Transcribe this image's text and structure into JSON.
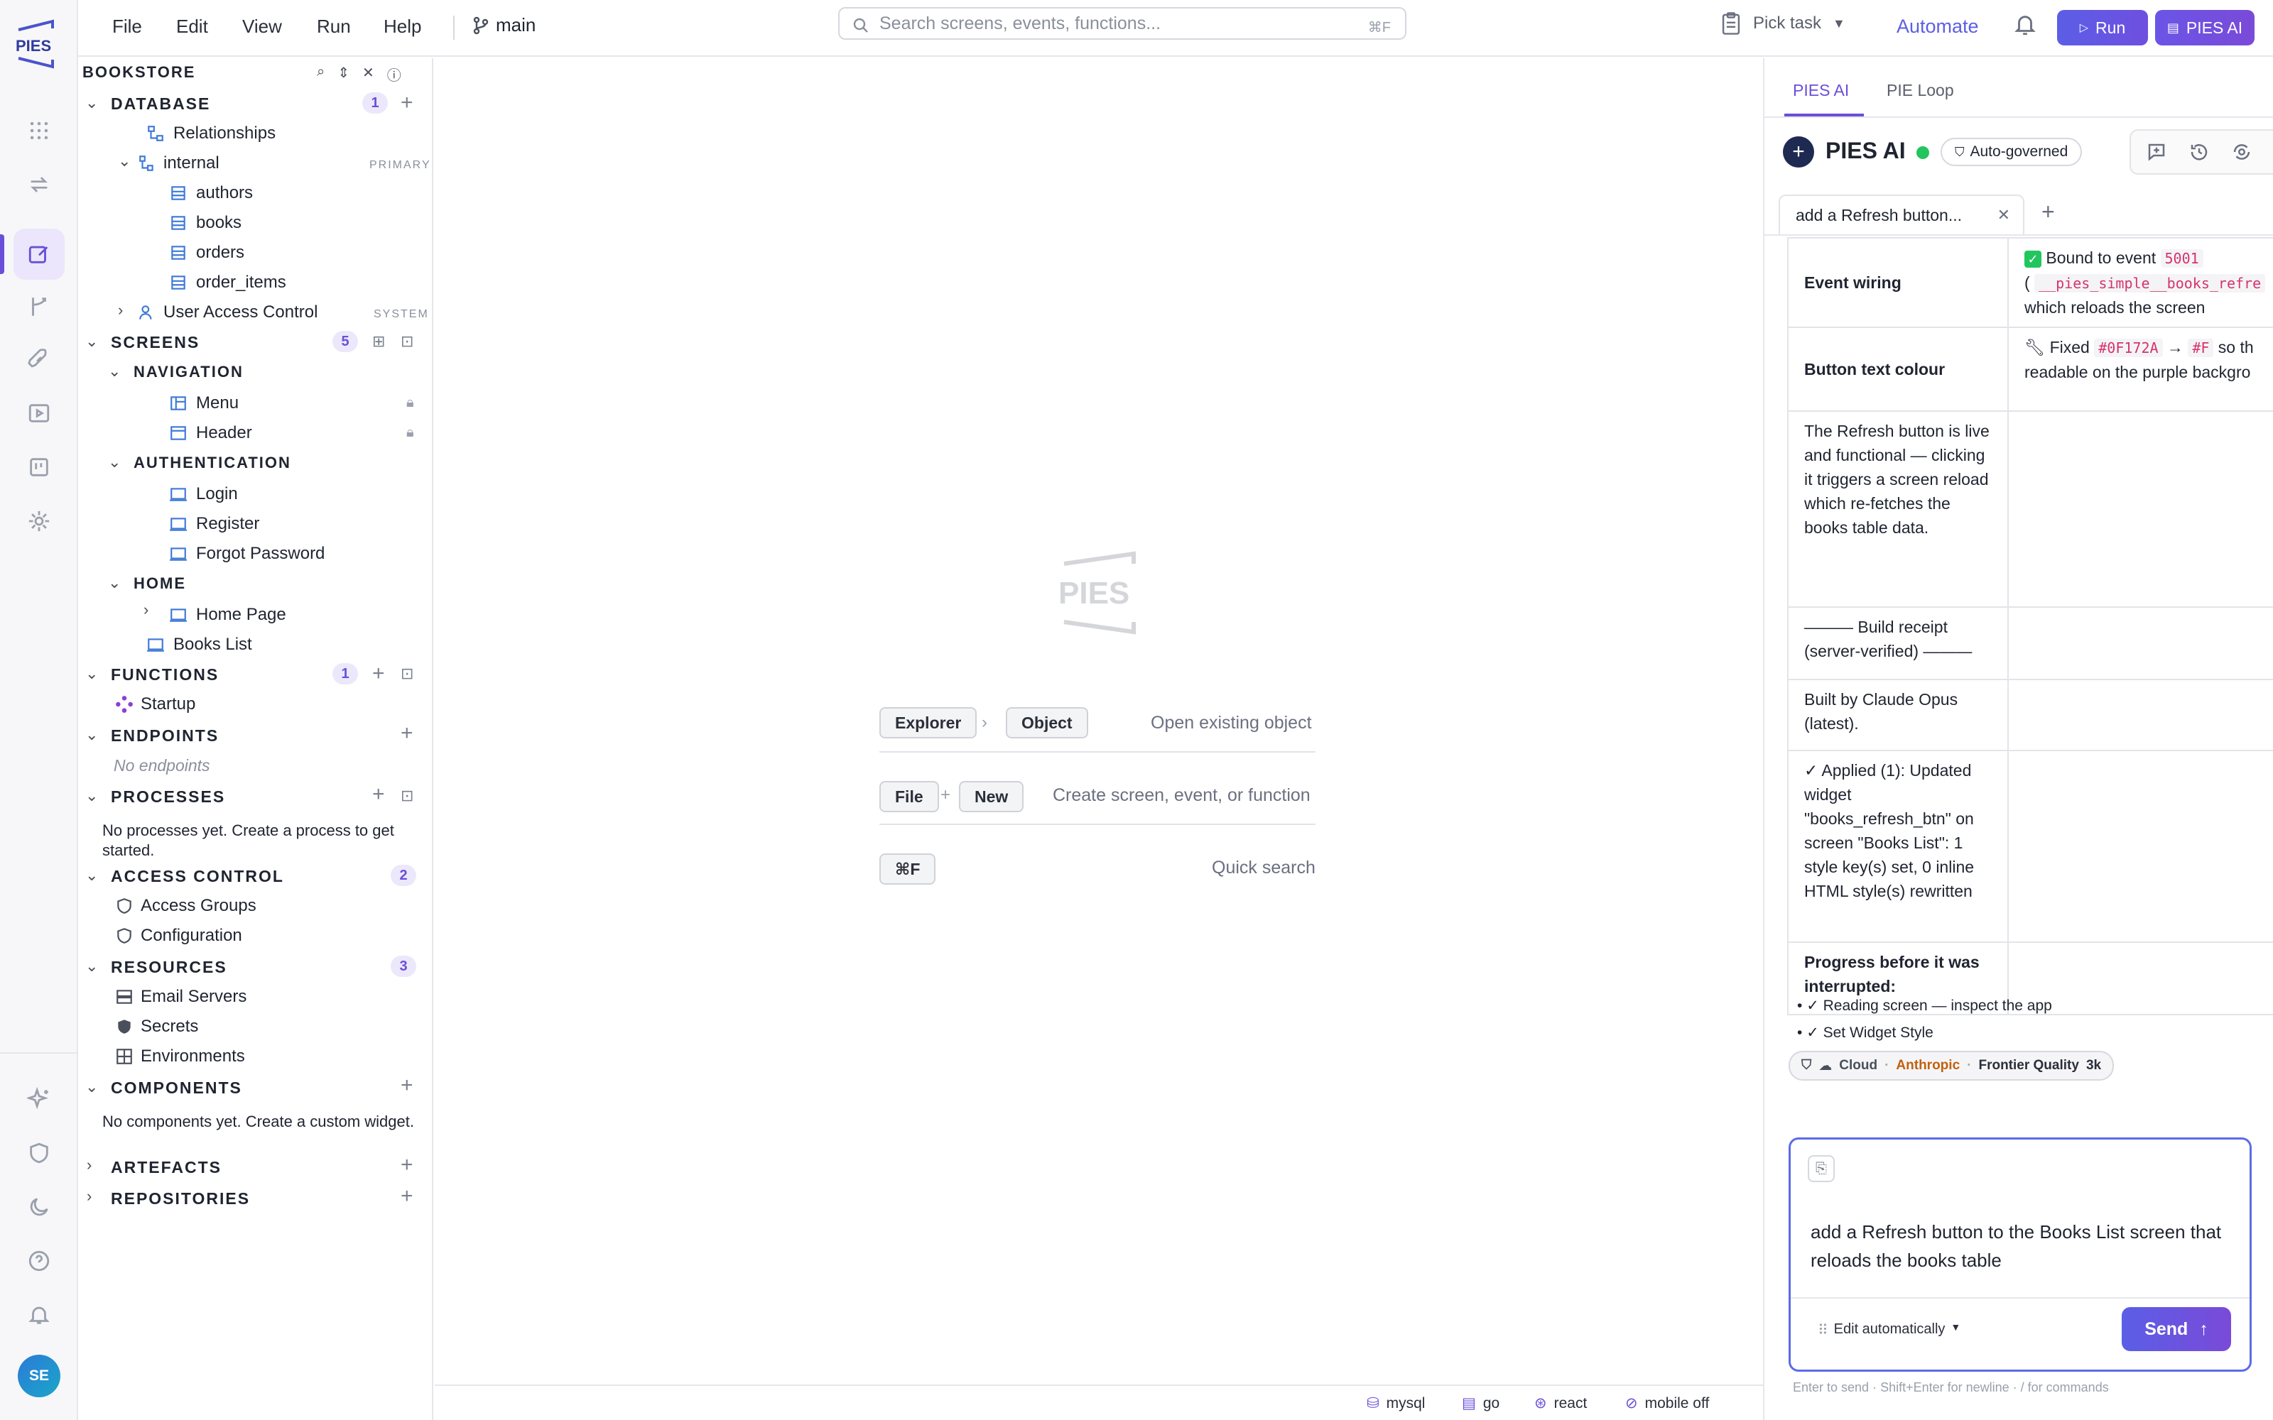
{
  "app": {
    "logo_text": "PIES"
  },
  "topbar": {
    "menu": [
      "File",
      "Edit",
      "View",
      "Run",
      "Help"
    ],
    "branch": "main",
    "search_placeholder": "Search screens, events, functions...",
    "search_shortcut": "⌘F",
    "pick_task": "Pick task",
    "automate": "Automate",
    "run": "Run",
    "pies_ai": "PIES AI"
  },
  "sidebar": {
    "title": "BOOKSTORE",
    "database": {
      "label": "DATABASE",
      "count": "1",
      "relationships": "Relationships",
      "schema": "internal",
      "schema_tag": "PRIMARY",
      "tables": [
        "authors",
        "books",
        "orders",
        "order_items"
      ],
      "uac": "User Access Control",
      "uac_tag": "SYSTEM"
    },
    "screens": {
      "label": "SCREENS",
      "count": "5",
      "navigation": "NAVIGATION",
      "nav_items": [
        "Menu",
        "Header"
      ],
      "authentication": "AUTHENTICATION",
      "auth_items": [
        "Login",
        "Register",
        "Forgot Password"
      ],
      "home": "HOME",
      "home_items": [
        "Home Page"
      ],
      "books_list": "Books List"
    },
    "functions": {
      "label": "FUNCTIONS",
      "count": "1",
      "items": [
        "Startup"
      ]
    },
    "endpoints": {
      "label": "ENDPOINTS",
      "empty": "No endpoints"
    },
    "processes": {
      "label": "PROCESSES",
      "empty": "No processes yet. Create a process to get started."
    },
    "access_control": {
      "label": "ACCESS CONTROL",
      "count": "2",
      "items": [
        "Access Groups",
        "Configuration"
      ]
    },
    "resources": {
      "label": "RESOURCES",
      "count": "3",
      "items": [
        "Email Servers",
        "Secrets",
        "Environments"
      ]
    },
    "components": {
      "label": "COMPONENTS",
      "empty": "No components yet. Create a custom widget."
    },
    "artefacts": {
      "label": "ARTEFACTS"
    },
    "repositories": {
      "label": "REPOSITORIES"
    }
  },
  "main": {
    "watermark": "PIES",
    "shortcut1": {
      "k1": "Explorer",
      "sep": "›",
      "k2": "Object",
      "hint": "Open existing object"
    },
    "shortcut2": {
      "k1": "File",
      "sep": "+",
      "k2": "New",
      "hint": "Create screen, event, or function"
    },
    "shortcut3": {
      "k1": "⌘F",
      "hint": "Quick search"
    }
  },
  "statusbar": {
    "items": [
      "mysql",
      "go",
      "react",
      "mobile off"
    ]
  },
  "rail": {
    "avatar": "SE"
  },
  "rpanel": {
    "tabs": [
      "PIES AI",
      "PIE Loop"
    ],
    "title": "PIES AI",
    "governed": "Auto-governed",
    "chat_tab": "add a Refresh button...",
    "rows": [
      {
        "k": "Event wiring",
        "v1": "Bound to event",
        "code1": "5001",
        "v2": "(",
        "code2": "__pies_simple__books_refre",
        "v3": "which reloads the screen"
      },
      {
        "k": "Button text colour",
        "v1": "Fixed",
        "code1": "#0F172A",
        "v2": "→",
        "code2": "#F",
        "v3": "so th",
        "v4": "readable on the purple backgro"
      },
      {
        "k": "The Refresh button is live and functional — clicking it triggers a screen reload which re-fetches the books table data."
      },
      {
        "k": "——— Build receipt (server-verified) ———"
      },
      {
        "k": "Built by Claude Opus (latest)."
      },
      {
        "k": "✓ Applied (1): Updated widget \"books_refresh_btn\" on screen \"Books List\": 1 style key(s) set, 0 inline HTML style(s) rewritten"
      },
      {
        "k": "Progress before it was interrupted:"
      }
    ],
    "progress": [
      "✓ Reading screen — inspect the app",
      "✓ Set Widget Style"
    ],
    "model_chip": {
      "cloud": "Cloud",
      "provider": "Anthropic",
      "quality": "Frontier Quality",
      "tokens": "3k"
    },
    "composer_text": "add a Refresh button to the Books List screen that reloads the books table",
    "mode": "Edit automatically",
    "send": "Send",
    "footer_hint": "Enter to send · Shift+Enter for newline · / for commands"
  }
}
